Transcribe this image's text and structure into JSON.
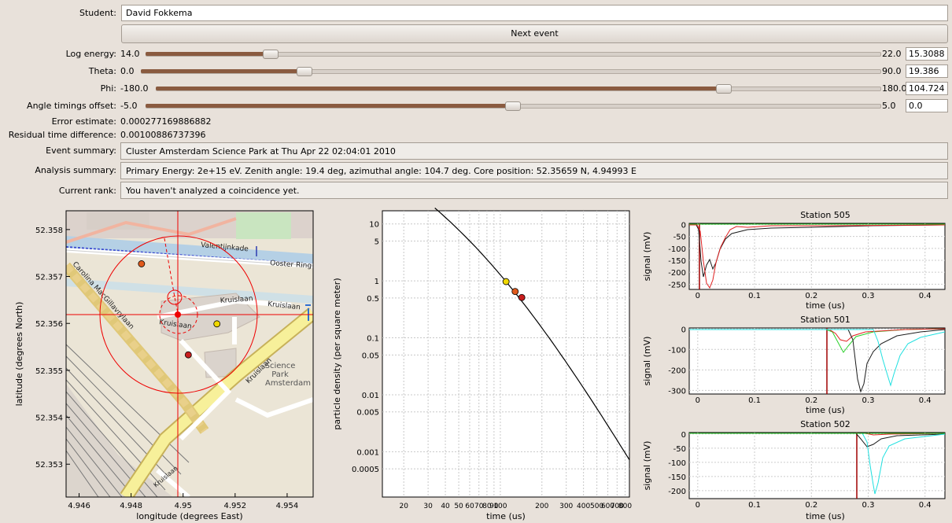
{
  "form": {
    "student_label": "Student:",
    "student_value": "David Fokkema",
    "next_button": "Next event"
  },
  "sliders": [
    {
      "label": "Log energy:",
      "min": "14.0",
      "max": "22.0",
      "value": "15.3088",
      "fraction": 0.1636
    },
    {
      "label": "Theta:",
      "min": "0.0",
      "max": "90.0",
      "value": "19.386",
      "fraction": 0.2154
    },
    {
      "label": "Phi:",
      "min": "-180.0",
      "max": "180.0",
      "value": "104.724",
      "fraction": 0.7909
    },
    {
      "label": "Angle timings offset:",
      "min": "-5.0",
      "max": "5.0",
      "value": "0.0",
      "fraction": 0.5
    }
  ],
  "info": {
    "error_label": "Error estimate:",
    "error_value": "0.000277169886882",
    "residual_label": "Residual time difference:",
    "residual_value": "0.00100886737396",
    "event_label": "Event summary:",
    "event_value": "Cluster Amsterdam Science Park at Thu Apr 22 02:04:01 2010",
    "analysis_label": "Analysis summary:",
    "analysis_value": "Primary Energy: 2e+15 eV.  Zenith angle: 19.4 deg, azimuthal angle: 104.7 deg. Core position: 52.35659 N, 4.94993 E",
    "rank_label": "Current rank:",
    "rank_value": "You haven't analyzed a coincidence yet."
  },
  "map": {
    "xlabel": "longitude (degrees East)",
    "ylabel": "latitude (degrees North)",
    "x_ticks": [
      "4.946",
      "4.948",
      "4.95",
      "4.952",
      "4.954"
    ],
    "y_ticks": [
      "52.358",
      "52.357",
      "52.356",
      "52.355",
      "52.354",
      "52.353"
    ],
    "street_labels": [
      "Valentijnkade",
      "Ooster Ring",
      "Kruislaan",
      "Kruislaan",
      "Kruislaan",
      "Kruislaan",
      "Carolina MacGillavrylaan",
      "Science",
      "Park",
      "Amsterdam",
      "Kruislaan"
    ],
    "stations": [
      {
        "lon": 4.9484,
        "lat": 52.35727,
        "color": "#e05a1c"
      },
      {
        "lon": 4.9513,
        "lat": 52.35599,
        "color": "#f0d800"
      },
      {
        "lon": 4.9502,
        "lat": 52.35533,
        "color": "#c81e1e"
      }
    ],
    "core": {
      "lon": 4.94993,
      "lat": 52.35659
    }
  },
  "ldf_chart": {
    "type": "line",
    "xlabel": "time (us)",
    "ylabel": "particle density (per square meter)",
    "x_ticks": [
      "20",
      "30",
      "40",
      "50",
      "60",
      "70",
      "80",
      "90",
      "100",
      "200",
      "300",
      "400",
      "500",
      "600",
      "700",
      "800"
    ],
    "y_ticks": [
      "10",
      "5",
      "1",
      "0.5",
      "0.1",
      "0.05",
      "0.01",
      "0.005",
      "0.001",
      "0.0005"
    ],
    "points": [
      {
        "r": 110,
        "density": 0.97,
        "color": "#f0d800"
      },
      {
        "r": 128,
        "density": 0.65,
        "color": "#e05a1c"
      },
      {
        "r": 143,
        "density": 0.51,
        "color": "#c81e1e"
      }
    ]
  },
  "traces": [
    {
      "title": "Station 505",
      "ylabel": "signal (mV)",
      "xlabel": "time (us)",
      "y_ticks": [
        "0",
        "-50",
        "-100",
        "-150",
        "-200",
        "-250"
      ],
      "x_ticks": [
        "0",
        "0.1",
        "0.2",
        "0.3",
        "0.4"
      ]
    },
    {
      "title": "Station 501",
      "ylabel": "signal (mV)",
      "xlabel": "time (us)",
      "y_ticks": [
        "0",
        "-100",
        "-200",
        "-300"
      ],
      "x_ticks": [
        "0",
        "0.1",
        "0.2",
        "0.3",
        "0.4"
      ]
    },
    {
      "title": "Station 502",
      "ylabel": "signal (mV)",
      "xlabel": "time (us)",
      "y_ticks": [
        "0",
        "-50",
        "-100",
        "-150",
        "-200"
      ],
      "x_ticks": [
        "0",
        "0.1",
        "0.2",
        "0.3",
        "0.4"
      ]
    }
  ]
}
